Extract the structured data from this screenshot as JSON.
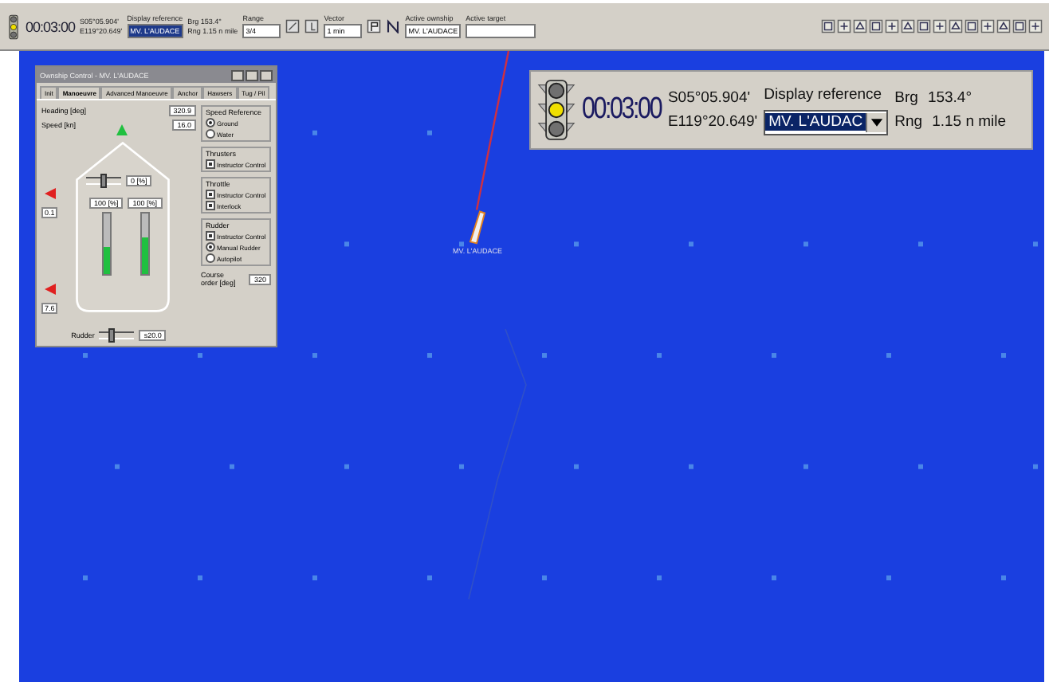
{
  "toolbar": {
    "lamps": [
      {
        "on": false
      },
      {
        "on": true
      },
      {
        "on": false
      }
    ],
    "time": "00:03:00",
    "lat": "S05°05.904'",
    "lon": "E119°20.649'",
    "display_reference_label": "Display reference",
    "display_reference": "MV. L'AUDACE",
    "brg": "Brg  153.4°",
    "rng": "Rng  1.15 n mile",
    "range_label": "Range",
    "range": "3/4",
    "vector_label": "Vector",
    "vector": "1 min",
    "active_ownship_label": "Active ownship",
    "active_ownship": "MV. L'AUDACE",
    "active_target_label": "Active target"
  },
  "control_window": {
    "title": "Ownship Control - MV. L'AUDACE",
    "tabs": [
      {
        "label": "Init",
        "selected": false
      },
      {
        "label": "Manoeuvre",
        "selected": true
      },
      {
        "label": "Advanced Manoeuvre",
        "selected": false
      },
      {
        "label": "Anchor",
        "selected": false
      },
      {
        "label": "Hawsers",
        "selected": false
      },
      {
        "label": "Tug / Pil",
        "selected": false
      }
    ],
    "heading_label": "Heading  [deg]",
    "heading": "320.9",
    "speed_label": "Speed   [kn]",
    "speed": "16.0",
    "thruster": {
      "level": 0.5,
      "value": "0  [%]"
    },
    "throttles": [
      {
        "value": "100  [%]",
        "level": 0.45
      },
      {
        "value": "100  [%]",
        "level": 0.6
      }
    ],
    "side_values": [
      "0.1",
      "7.6"
    ],
    "rudder": {
      "label": "Rudder",
      "level": 0.35,
      "value": "s20.0"
    },
    "groups": [
      {
        "title": "Speed Reference",
        "items": [
          {
            "kind": "radio",
            "label": "Ground",
            "checked": true
          },
          {
            "kind": "radio",
            "label": "Water",
            "checked": false
          }
        ]
      },
      {
        "title": "Thrusters",
        "items": [
          {
            "kind": "check",
            "label": "Instructor Control",
            "checked": true
          }
        ]
      },
      {
        "title": "Throttle",
        "items": [
          {
            "kind": "check",
            "label": "Instructor Control",
            "checked": true
          },
          {
            "kind": "check",
            "label": "Interlock",
            "checked": true
          }
        ]
      },
      {
        "title": "Rudder",
        "items": [
          {
            "kind": "check",
            "label": "Instructor Control",
            "checked": true
          },
          {
            "kind": "radio",
            "label": "Manual Rudder",
            "checked": true
          },
          {
            "kind": "radio",
            "label": "Autopilot",
            "checked": false
          }
        ]
      }
    ],
    "course_label": "Course order [deg]",
    "course": "320"
  },
  "info_panel": {
    "lamps": [
      {
        "on": false
      },
      {
        "on": true
      },
      {
        "on": false
      }
    ],
    "time": "00:03:00",
    "lat": "S05°05.904'",
    "lon": "E119°20.649'",
    "display_reference_label": "Display reference",
    "display_reference": "MV. L'AUDAC",
    "brg_label": "Brg",
    "brg": "153.4°",
    "rng_label": "Rng",
    "rng": "1.15 n mile"
  },
  "map": {
    "ship_label": "MV. L'AUDACE"
  }
}
